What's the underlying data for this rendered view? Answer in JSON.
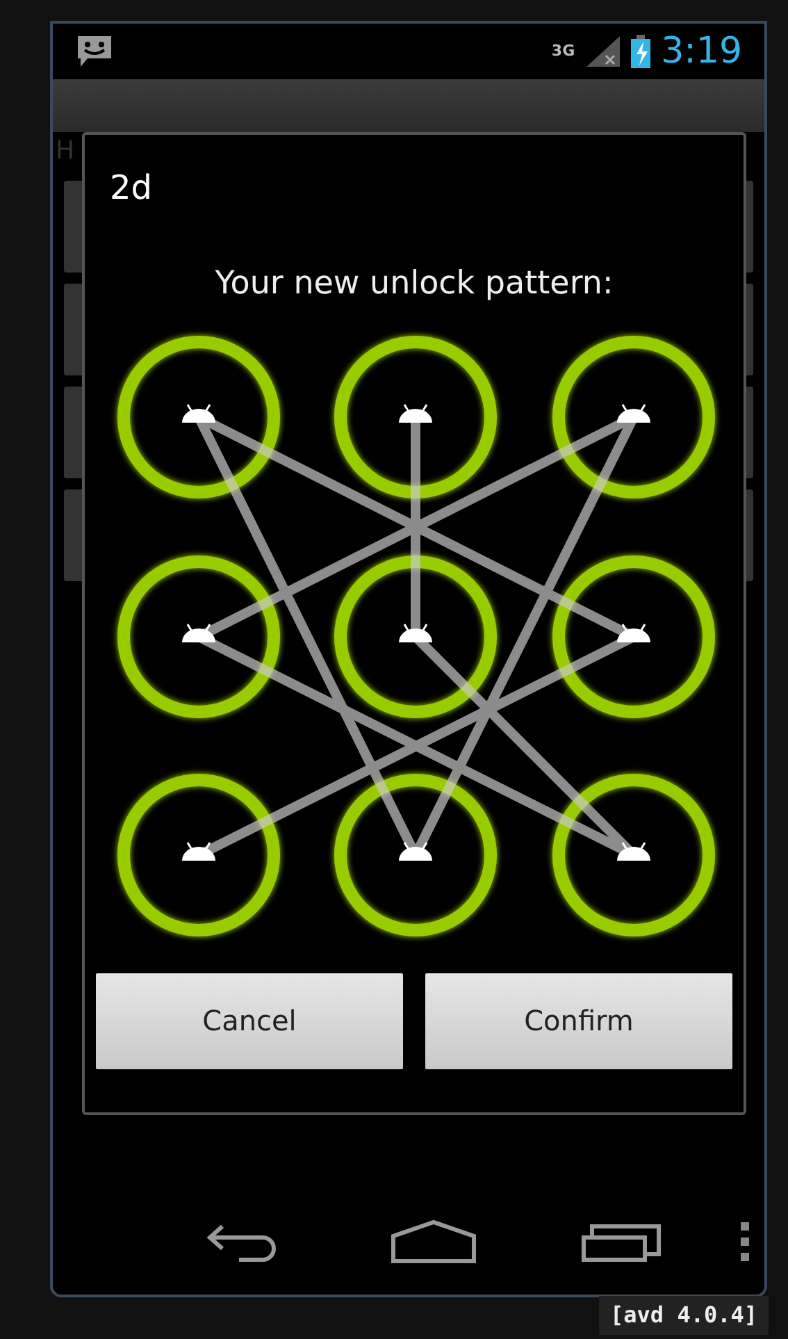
{
  "status_bar": {
    "network": "3G",
    "time": "3:19"
  },
  "background": {
    "text": "H"
  },
  "dialog": {
    "title": "2d",
    "message": "Your new unlock pattern:",
    "dots": [
      {
        "selected": true
      },
      {
        "selected": true
      },
      {
        "selected": true
      },
      {
        "selected": true
      },
      {
        "selected": true
      },
      {
        "selected": true
      },
      {
        "selected": true
      },
      {
        "selected": true
      },
      {
        "selected": true
      }
    ],
    "buttons": [
      {
        "label": "Cancel"
      },
      {
        "label": "Confirm"
      }
    ]
  },
  "emulator_label": "[avd 4.0.4]"
}
